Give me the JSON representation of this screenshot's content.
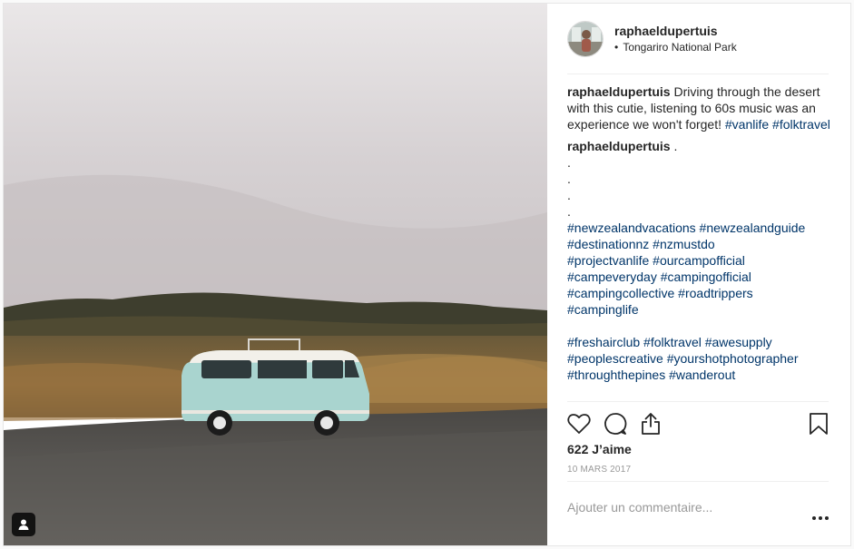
{
  "post": {
    "username": "raphaeldupertuis",
    "location": "Tongariro National Park",
    "caption": {
      "author": "raphaeldupertuis",
      "text": "Driving through the desert with this cutie, listening to 60s music was an experience we won't forget!",
      "tags": [
        "#vanlife",
        "#folktravel"
      ]
    },
    "first_comment": {
      "author": "raphaeldupertuis",
      "dots": [
        ".",
        ".",
        ".",
        "."
      ],
      "tag_lines": [
        "#newzealandvacations #newzealandguide",
        "#destinationnz #nzmustdo",
        "#projectvanlife #ourcampofficial",
        "#campeveryday #campingofficial",
        "#campingcollective #roadtrippers",
        "#campinglife"
      ],
      "tag_lines_2": [
        "#freshairclub #folktravel #awesupply",
        "#peoplescreative #yourshotphotographer",
        "#throughthepines #wanderout"
      ]
    },
    "likes": "622 J’aime",
    "date": "10 mars 2017",
    "comment_placeholder": "Ajouter un commentaire..."
  },
  "icons": {
    "like": "heart-icon",
    "comment": "comment-icon",
    "share": "share-icon",
    "save": "bookmark-icon",
    "more": "more-options-icon",
    "tagged": "user-tag-icon"
  }
}
